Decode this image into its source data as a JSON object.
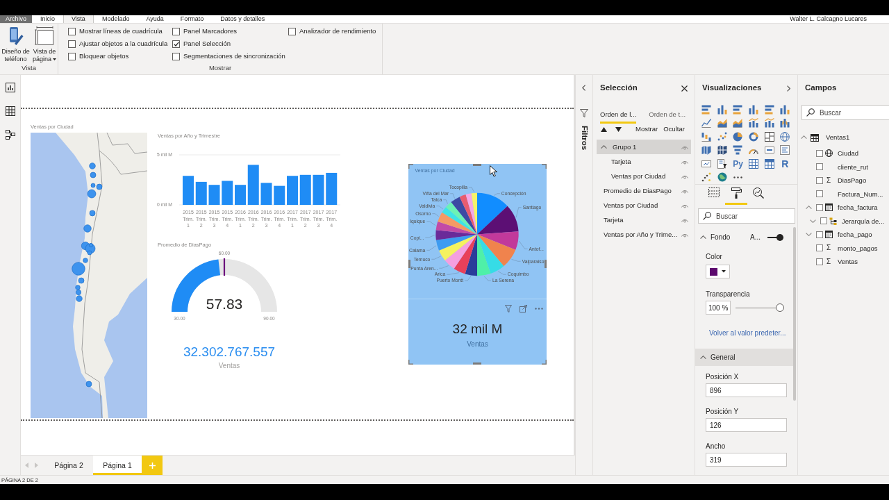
{
  "title_bar": {
    "tabs": [
      {
        "label": "Archivo",
        "kind": "file",
        "selected": false
      },
      {
        "label": "Inicio",
        "kind": "tab",
        "selected": false
      },
      {
        "label": "Vista",
        "kind": "tab",
        "selected": true
      },
      {
        "label": "Modelado",
        "kind": "tab",
        "selected": false
      },
      {
        "label": "Ayuda",
        "kind": "tab",
        "selected": false
      },
      {
        "label": "Formato",
        "kind": "tab",
        "selected": false
      },
      {
        "label": "Datos y detalles",
        "kind": "tab",
        "selected": false
      }
    ],
    "user": "Walter L. Calcagno Lucares"
  },
  "ribbon": {
    "view_group": {
      "label": "Vista",
      "buttons": [
        {
          "label": "Diseño de teléfono",
          "dropdown": false
        },
        {
          "label": "Vista de página",
          "dropdown": true
        }
      ]
    },
    "show_group": {
      "label": "Mostrar",
      "options": [
        {
          "label": "Mostrar líneas de cuadrícula",
          "checked": false
        },
        {
          "label": "Ajustar objetos a la cuadrícula",
          "checked": false
        },
        {
          "label": "Bloquear objetos",
          "checked": false
        },
        {
          "label": "Panel Marcadores",
          "checked": false
        },
        {
          "label": "Panel Selección",
          "checked": true
        },
        {
          "label": "Segmentaciones de sincronización",
          "checked": false
        },
        {
          "label": "Analizador de rendimiento",
          "checked": false
        }
      ]
    }
  },
  "canvas": {
    "map": {
      "title": "Ventas por Ciudad"
    },
    "column_chart": {
      "chart_data": {
        "type": "bar",
        "title": "Ventas por Año y Trimestre",
        "categories": [
          "2015 Trim. 1",
          "2015 Trim. 2",
          "2015 Trim. 3",
          "2015 Trim. 4",
          "2016 Trim. 1",
          "2016 Trim. 2",
          "2016 Trim. 3",
          "2016 Trim. 4",
          "2017 Trim. 1",
          "2017 Trim. 2",
          "2017 Trim. 3",
          "2017 Trim. 4"
        ],
        "values": [
          2.9,
          2.3,
          2.0,
          2.4,
          2.0,
          4.0,
          2.2,
          1.9,
          2.9,
          3.0,
          3.0,
          3.2
        ],
        "ylim": [
          0,
          5
        ],
        "yticks": [
          {
            "value": 0,
            "label": "0 mil M"
          },
          {
            "value": 5,
            "label": "5 mil M"
          }
        ]
      }
    },
    "gauge": {
      "title": "Promedio de DiasPago",
      "value": "57.83",
      "level": 0.464,
      "min": "30.00",
      "max": "90.00",
      "target": {
        "label": "60.00",
        "level": 0.5
      }
    },
    "card": {
      "value": "32.302.767.557",
      "label": "Ventas"
    },
    "group": {
      "selected": true,
      "pie": {
        "title": "Ventas por Ciudad",
        "labels": [
          "Tocopilla",
          "Viña del Mar",
          "Concepción",
          "Talca",
          "Valdivia",
          "Santiago",
          "Osorno",
          "Iquique",
          "Copi...",
          "Calama",
          "Antof...",
          "Temuco",
          "Valparaíso",
          "Punta Aren...",
          "Arica",
          "Coquimbo",
          "Puerto Montt",
          "La Serena"
        ]
      },
      "card": {
        "value": "32 mil M",
        "label": "Ventas"
      }
    }
  },
  "page_tabs": [
    {
      "label": "Página 2",
      "selected": false
    },
    {
      "label": "Página 1",
      "selected": true
    }
  ],
  "filters_pane": {
    "label": "Filtros"
  },
  "selection_pane": {
    "title": "Selección",
    "tabs": [
      {
        "label": "Orden de l...",
        "selected": true
      },
      {
        "label": "Orden de t...",
        "selected": false
      }
    ],
    "actions": [
      "Mostrar",
      "Ocultar"
    ],
    "items": [
      {
        "label": "Grupo 1",
        "selected": true,
        "visible": true,
        "expanded": true,
        "children": [
          {
            "label": "Tarjeta",
            "selected": false,
            "visible": true
          },
          {
            "label": "Ventas por Ciudad",
            "selected": false,
            "visible": true
          }
        ]
      },
      {
        "label": "Promedio de DiasPago",
        "selected": false,
        "visible": true
      },
      {
        "label": "Ventas por Ciudad",
        "selected": false,
        "visible": true
      },
      {
        "label": "Tarjeta",
        "selected": false,
        "visible": true
      },
      {
        "label": "Ventas por Año y Trime...",
        "selected": false,
        "visible": true
      }
    ]
  },
  "visualizations_pane": {
    "title": "Visualizaciones",
    "gallery_glyphs": [
      "Py",
      "R"
    ],
    "pane_tabs": [
      {
        "selected": false
      },
      {
        "selected": true
      },
      {
        "selected": false
      }
    ],
    "search": {
      "placeholder": "Buscar"
    },
    "sections": [
      {
        "label": "Fondo",
        "expanded": true,
        "highlighted": false,
        "toggle": {
          "label": "A...",
          "on": true
        },
        "fields": [
          {
            "kind": "color",
            "label": "Color",
            "color": "#5c0a6e"
          },
          {
            "kind": "slider",
            "label": "Transparencia",
            "value": "100 %",
            "level": 1
          },
          {
            "kind": "link",
            "label": "Volver al valor predeter..."
          }
        ]
      },
      {
        "label": "General",
        "expanded": true,
        "highlighted": true,
        "fields": [
          {
            "kind": "text",
            "label": "Posición X",
            "value": "896"
          },
          {
            "kind": "text",
            "label": "Posición Y",
            "value": "126"
          },
          {
            "kind": "text",
            "label": "Ancho",
            "value": "319"
          }
        ]
      }
    ]
  },
  "fields_pane": {
    "title": "Campos",
    "search": {
      "placeholder": "Buscar"
    },
    "tables": [
      {
        "label": "Ventas1",
        "expanded": true,
        "children": [
          {
            "label": "Ciudad",
            "kind": "geo",
            "checked": false
          },
          {
            "label": "cliente_rut",
            "kind": "plain",
            "checked": false
          },
          {
            "label": "DiasPago",
            "kind": "sum",
            "glyph": "Σ",
            "checked": false
          },
          {
            "label": "Factura_Num...",
            "kind": "plain",
            "checked": false
          },
          {
            "label": "fecha_factura",
            "kind": "date",
            "checked": false,
            "expanded": true,
            "children": [
              {
                "label": "Jerarquía de...",
                "kind": "hierarchy",
                "checked": false,
                "expanded": false
              }
            ]
          },
          {
            "label": "fecha_pago",
            "kind": "date",
            "checked": false,
            "expanded": false
          },
          {
            "label": "monto_pagos",
            "kind": "sum",
            "glyph": "Σ",
            "checked": false
          },
          {
            "label": "Ventas",
            "kind": "sum",
            "glyph": "Σ",
            "checked": false
          }
        ]
      }
    ]
  },
  "status_bar": "PÁGINA 2 DE 2"
}
